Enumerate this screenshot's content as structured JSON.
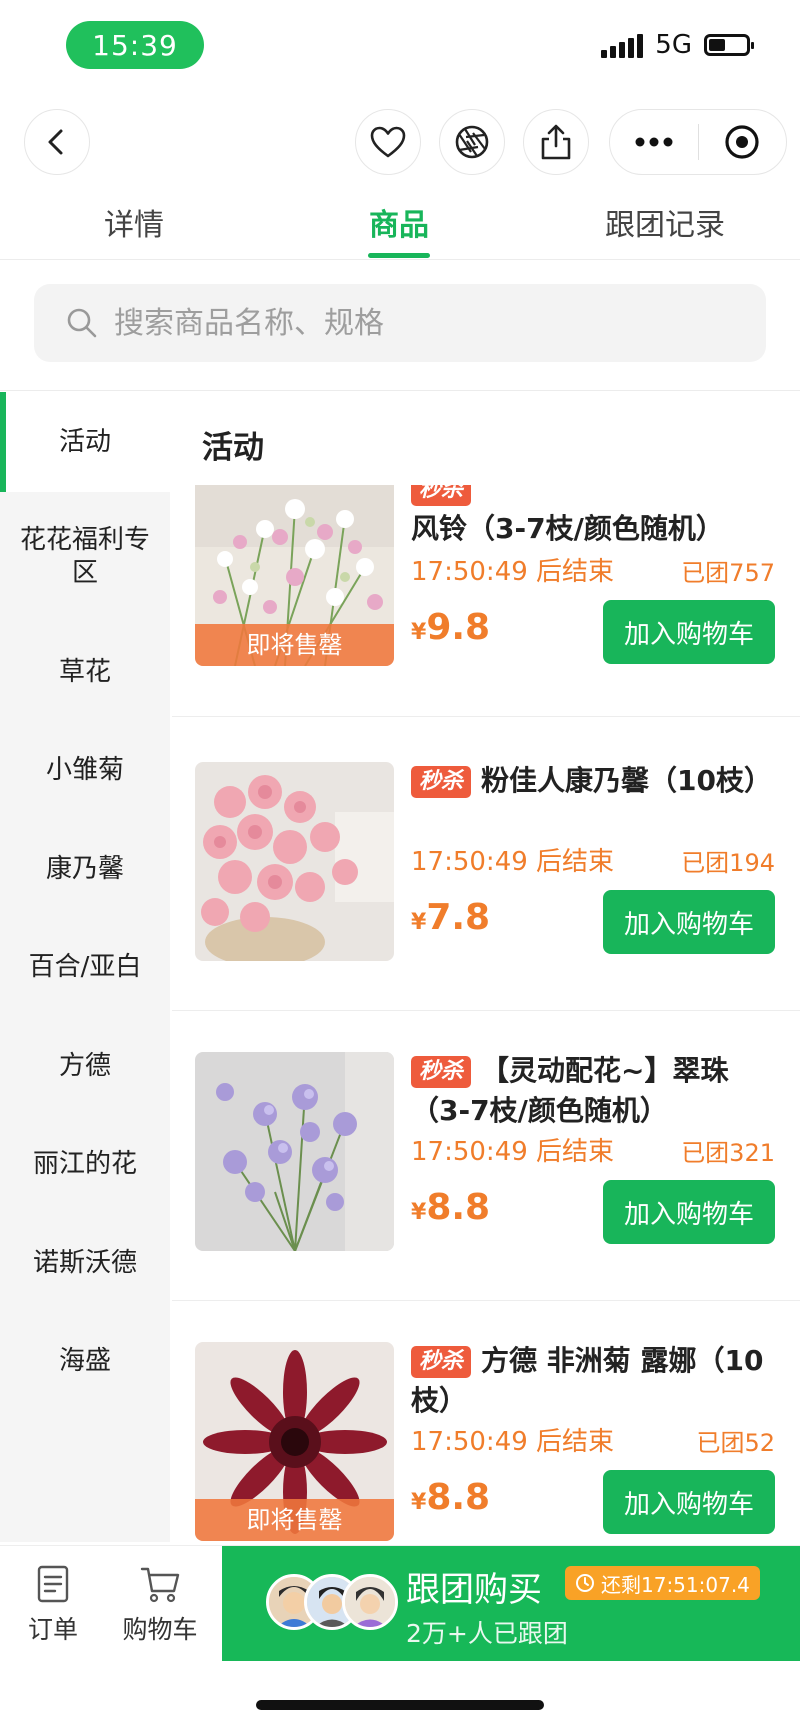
{
  "status_bar": {
    "time": "15:39",
    "network": "5G"
  },
  "tabs": [
    {
      "label": "详情"
    },
    {
      "label": "商品"
    },
    {
      "label": "跟团记录"
    }
  ],
  "search": {
    "placeholder": "搜索商品名称、规格"
  },
  "sidebar": {
    "items": [
      {
        "label": "活动"
      },
      {
        "label": "花花福利专区"
      },
      {
        "label": "草花"
      },
      {
        "label": "小雏菊"
      },
      {
        "label": "康乃馨"
      },
      {
        "label": "百合/亚白"
      },
      {
        "label": "方德"
      },
      {
        "label": "丽江的花"
      },
      {
        "label": "诺斯沃德"
      },
      {
        "label": "海盛"
      }
    ]
  },
  "section_title": "活动",
  "products": [
    {
      "tag": "秒杀",
      "title": "风铃（3-7枝/颜色随机）",
      "countdown": "17:50:49 后结束",
      "joined": "已团757",
      "currency": "¥",
      "price": "9.8",
      "button": "加入购物车",
      "badge": "即将售罄"
    },
    {
      "tag": "秒杀",
      "title": "粉佳人康乃馨（10枝）",
      "countdown": "17:50:49 后结束",
      "joined": "已团194",
      "currency": "¥",
      "price": "7.8",
      "button": "加入购物车"
    },
    {
      "tag": "秒杀",
      "title": "【灵动配花~】翠珠（3-7枝/颜色随机）",
      "countdown": "17:50:49 后结束",
      "joined": "已团321",
      "currency": "¥",
      "price": "8.8",
      "button": "加入购物车"
    },
    {
      "tag": "秒杀",
      "title": "方德 非洲菊 露娜（10枝）",
      "countdown": "17:50:49 后结束",
      "joined": "已团52",
      "currency": "¥",
      "price": "8.8",
      "button": "加入购物车",
      "badge": "即将售罄"
    }
  ],
  "bottom_bar": {
    "order_label": "订单",
    "cart_label": "购物车",
    "group_buy_title": "跟团购买",
    "remaining": "还剩17:51:07.4",
    "joined_count": "2万+人已跟团"
  },
  "colors": {
    "accent": "#18b55a",
    "orange": "#f07d2b",
    "tag_red": "#ee5b3c"
  }
}
